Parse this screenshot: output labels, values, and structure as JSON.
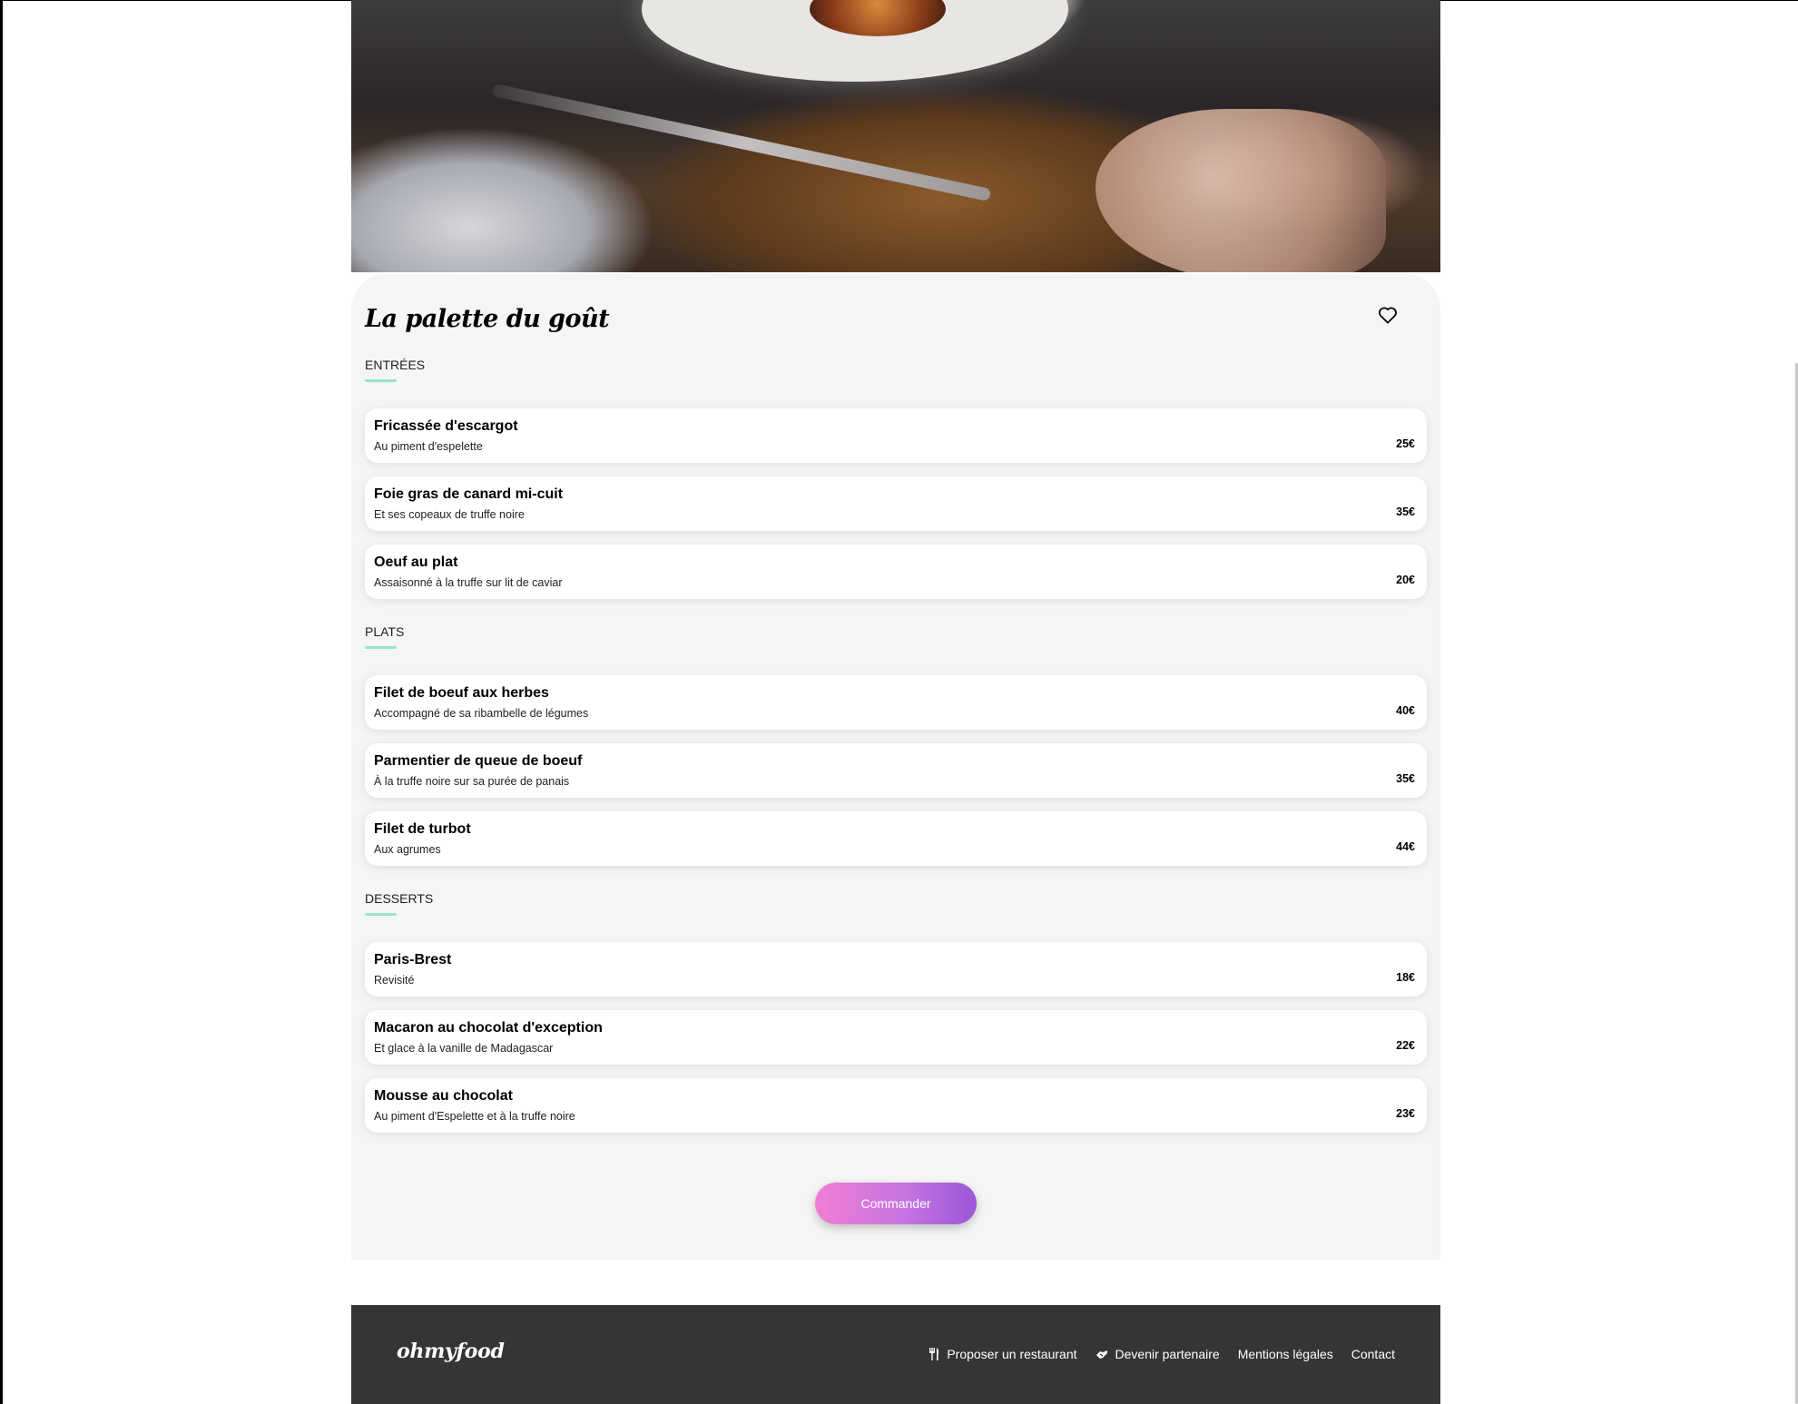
{
  "restaurant": {
    "name": "La palette du goût"
  },
  "icons": {
    "favorite": "heart-outline-icon",
    "propose": "fork-knife-icon",
    "partner": "handshake-icon"
  },
  "colors": {
    "accent_underline": "#99e2d0",
    "button_gradient_start": "#f07fd4",
    "button_gradient_end": "#9b56d7",
    "footer_background": "#353535",
    "card_background": "#f5f5f5"
  },
  "menu": {
    "sections": [
      {
        "title": "Entrées",
        "dishes": [
          {
            "name": "Fricassée d'escargot",
            "description": "Au piment d'espelette",
            "price": "25€"
          },
          {
            "name": "Foie gras de canard mi-cuit",
            "description": "Et ses copeaux de truffe noire",
            "price": "35€"
          },
          {
            "name": "Oeuf au plat",
            "description": "Assaisonné à la truffe sur lit de caviar",
            "price": "20€"
          }
        ]
      },
      {
        "title": "Plats",
        "dishes": [
          {
            "name": "Filet de boeuf aux herbes",
            "description": "Accompagné de sa ribambelle de légumes",
            "price": "40€"
          },
          {
            "name": "Parmentier de queue de boeuf",
            "description": "À la truffe noire sur sa purée de panais",
            "price": "35€"
          },
          {
            "name": "Filet de turbot",
            "description": "Aux agrumes",
            "price": "44€"
          }
        ]
      },
      {
        "title": "Desserts",
        "dishes": [
          {
            "name": "Paris-Brest",
            "description": "Revisité",
            "price": "18€"
          },
          {
            "name": "Macaron au chocolat d'exception",
            "description": "Et glace à la vanille de Madagascar",
            "price": "22€"
          },
          {
            "name": "Mousse au chocolat",
            "description": "Au piment d'Espelette et à la truffe noire",
            "price": "23€"
          }
        ]
      }
    ]
  },
  "order_button": {
    "label": "Commander"
  },
  "footer": {
    "logo": "ohmyfood",
    "links": [
      {
        "label": "Proposer un restaurant"
      },
      {
        "label": "Devenir partenaire"
      },
      {
        "label": "Mentions légales"
      },
      {
        "label": "Contact"
      }
    ]
  }
}
